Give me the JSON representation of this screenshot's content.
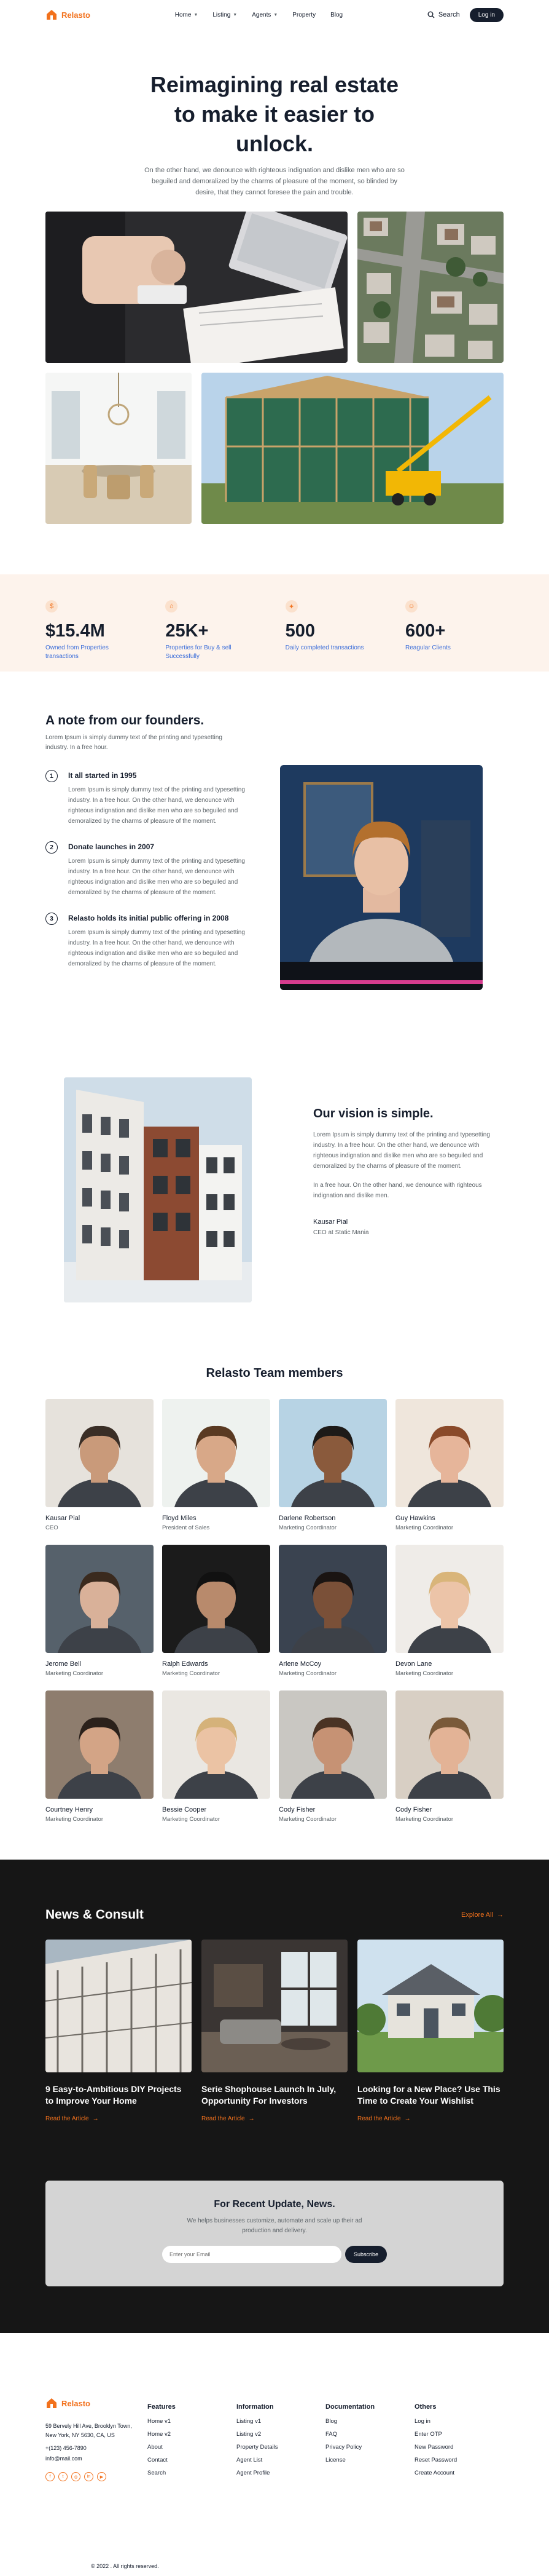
{
  "brand": {
    "name": "Relasto",
    "accent": "#f2711c",
    "dark": "#161e2d"
  },
  "nav": {
    "items": [
      {
        "label": "Home",
        "dropdown": true
      },
      {
        "label": "Listing",
        "dropdown": true
      },
      {
        "label": "Agents",
        "dropdown": true
      },
      {
        "label": "Property",
        "dropdown": false
      },
      {
        "label": "Blog",
        "dropdown": false
      }
    ],
    "search_label": "Search",
    "login_label": "Log in"
  },
  "hero": {
    "title": "Reimagining real estate to make it easier to unlock.",
    "text": "On the other hand, we denounce with righteous indignation and dislike men who are so beguiled and demoralized by the charms of pleasure of the moment, so blinded by desire, that they cannot foresee the pain and trouble."
  },
  "stats": [
    {
      "icon": "dollar-icon",
      "value": "$15.4M",
      "label": "Owned from Properties transactions"
    },
    {
      "icon": "home-icon",
      "value": "25K+",
      "label": "Properties for Buy & sell Successfully"
    },
    {
      "icon": "fire-icon",
      "value": "500",
      "label": "Daily completed transactions"
    },
    {
      "icon": "smile-icon",
      "value": "600+",
      "label": "Reagular Clients"
    }
  ],
  "founders": {
    "title": "A note from our founders.",
    "subtitle": "Lorem Ipsum is simply dummy text of the printing and typesetting industry. In a free hour.",
    "timeline": [
      {
        "num": "1",
        "title": "It all started in 1995",
        "text": "Lorem Ipsum is simply dummy text of the printing and typesetting industry. In a free hour. On the other hand, we denounce with righteous indignation and dislike men who are so beguiled and demoralized by the charms of pleasure of the moment."
      },
      {
        "num": "2",
        "title": "Donate launches in 2007",
        "text": "Lorem Ipsum is simply dummy text of the printing and typesetting industry. In a free hour. On the other hand, we denounce with righteous indignation and dislike men who are so beguiled and demoralized by the charms of pleasure of the moment."
      },
      {
        "num": "3",
        "title": "Relasto holds its initial public offering in 2008",
        "text": "Lorem Ipsum is simply dummy text of the printing and typesetting industry. In a free hour. On the other hand, we denounce with righteous indignation and dislike men who are so beguiled and demoralized by the charms of pleasure of the moment."
      }
    ]
  },
  "vision": {
    "title": "Our vision is simple.",
    "p1": "Lorem Ipsum is simply dummy text of the printing and typesetting industry. In a free hour. On the other hand, we denounce with righteous indignation and dislike men who are so beguiled and demoralized by the charms of pleasure of the moment.",
    "p2": "In a free hour. On the other hand, we denounce with righteous indignation and dislike men.",
    "name": "Kausar Pial",
    "role": "CEO at Static Mania"
  },
  "team": {
    "title": "Relasto Team members",
    "members": [
      {
        "name": "Kausar Pial",
        "role": "CEO"
      },
      {
        "name": "Floyd Miles",
        "role": "President of Sales"
      },
      {
        "name": "Darlene Robertson",
        "role": "Marketing Coordinator"
      },
      {
        "name": "Guy Hawkins",
        "role": "Marketing Coordinator"
      },
      {
        "name": "Jerome Bell",
        "role": "Marketing Coordinator"
      },
      {
        "name": "Ralph Edwards",
        "role": "Marketing Coordinator"
      },
      {
        "name": "Arlene McCoy",
        "role": "Marketing Coordinator"
      },
      {
        "name": "Devon Lane",
        "role": "Marketing Coordinator"
      },
      {
        "name": "Courtney Henry",
        "role": "Marketing Coordinator"
      },
      {
        "name": "Bessie Cooper",
        "role": "Marketing Coordinator"
      },
      {
        "name": "Cody Fisher",
        "role": "Marketing Coordinator"
      },
      {
        "name": "Cody Fisher",
        "role": "Marketing Coordinator"
      }
    ]
  },
  "news": {
    "title": "News & Consult",
    "explore_label": "Explore All",
    "articles": [
      {
        "title": "9 Easy-to-Ambitious DIY Projects to Improve Your Home",
        "link": "Read the Article"
      },
      {
        "title": "Serie Shophouse Launch In July, Opportunity For Investors",
        "link": "Read the Article"
      },
      {
        "title": "Looking for a New Place? Use This Time to Create Your Wishlist",
        "link": "Read the Article"
      }
    ]
  },
  "newsletter": {
    "title": "For Recent Update, News.",
    "text": "We helps businesses customize, automate and scale up their ad production and delivery.",
    "placeholder": "Enter your Email",
    "button": "Subscribe"
  },
  "footer": {
    "address": "59 Bervely Hill Ave, Brooklyn Town, New York, NY 5630, CA, US",
    "phone": "+(123) 456-7890",
    "email": "info@mail.com",
    "social": [
      "facebook-icon",
      "twitter-icon",
      "instagram-icon",
      "linkedin-icon",
      "youtube-icon"
    ],
    "columns": [
      {
        "title": "Features",
        "links": [
          "Home v1",
          "Home v2",
          "About",
          "Contact",
          "Search"
        ]
      },
      {
        "title": "Information",
        "links": [
          "Listing v1",
          "Listing v2",
          "Property Details",
          "Agent List",
          "Agent Profile"
        ]
      },
      {
        "title": "Documentation",
        "links": [
          "Blog",
          "FAQ",
          "Privacy Policy",
          "License"
        ]
      },
      {
        "title": "Others",
        "links": [
          "Log in",
          "Enter OTP",
          "New Password",
          "Reset Password",
          "Create Account"
        ]
      }
    ],
    "copyright": "© 2022 . All rights reserved."
  }
}
